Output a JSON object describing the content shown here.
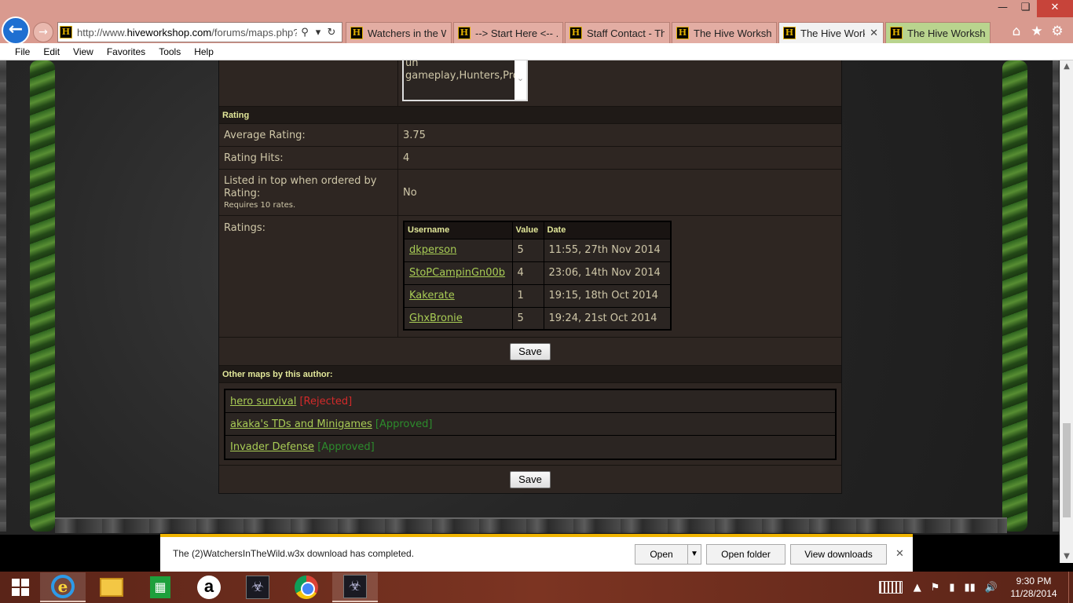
{
  "browser": {
    "address": {
      "url_prefix": "http://www.",
      "url_domain": "hiveworkshop.com",
      "url_path": "/forums/maps.php?p="
    },
    "tabs": [
      {
        "label": "Watchers in the Wi..."
      },
      {
        "label": "--> Start Here <-- ..."
      },
      {
        "label": "Staff Contact - Th..."
      },
      {
        "label": "The Hive Workshop"
      },
      {
        "label": "The Hive Works..."
      },
      {
        "label": "The Hive Workshop"
      }
    ],
    "menu": [
      "File",
      "Edit",
      "View",
      "Favorites",
      "Tools",
      "Help"
    ]
  },
  "page": {
    "tags_text": "un gameplay,Hunters,Props,akaka",
    "rating_section": {
      "header": "Rating",
      "average_label": "Average Rating:",
      "average_value": "3.75",
      "hits_label": "Rating Hits:",
      "hits_value": "4",
      "top_label": "Listed in top when ordered by Rating:",
      "top_note": "Requires 10 rates.",
      "top_value": "No",
      "ratings_label": "Ratings:",
      "columns": [
        "Username",
        "Value",
        "Date"
      ],
      "ratings": [
        {
          "username": "dkperson",
          "value": "5",
          "date": "11:55, 27th Nov 2014"
        },
        {
          "username": "StoPCampinGn00b",
          "value": "4",
          "date": "23:06, 14th Nov 2014"
        },
        {
          "username": "Kakerate",
          "value": "1",
          "date": "19:15, 18th Oct 2014"
        },
        {
          "username": "GhxBronie",
          "value": "5",
          "date": "19:24, 21st Oct 2014"
        }
      ]
    },
    "save_label": "Save",
    "other_maps": {
      "header": "Other maps by this author:",
      "maps": [
        {
          "name": "hero survival",
          "status": "[Rejected]"
        },
        {
          "name": "akaka's TDs and Minigames",
          "status": "[Approved]"
        },
        {
          "name": "Invader Defense",
          "status": "[Approved]"
        }
      ]
    }
  },
  "download_bar": {
    "message": "The (2)WatchersInTheWild.w3x download has completed.",
    "open_label": "Open",
    "open_folder_label": "Open folder",
    "view_downloads_label": "View downloads"
  },
  "taskbar": {
    "time": "9:30 PM",
    "date": "11/28/2014"
  },
  "colors": {
    "accent_header": "#e3e89a",
    "link": "#a8cc55",
    "rejected": "#d32a2a",
    "approved": "#2c8c2c",
    "download_accent": "#f0b400"
  }
}
